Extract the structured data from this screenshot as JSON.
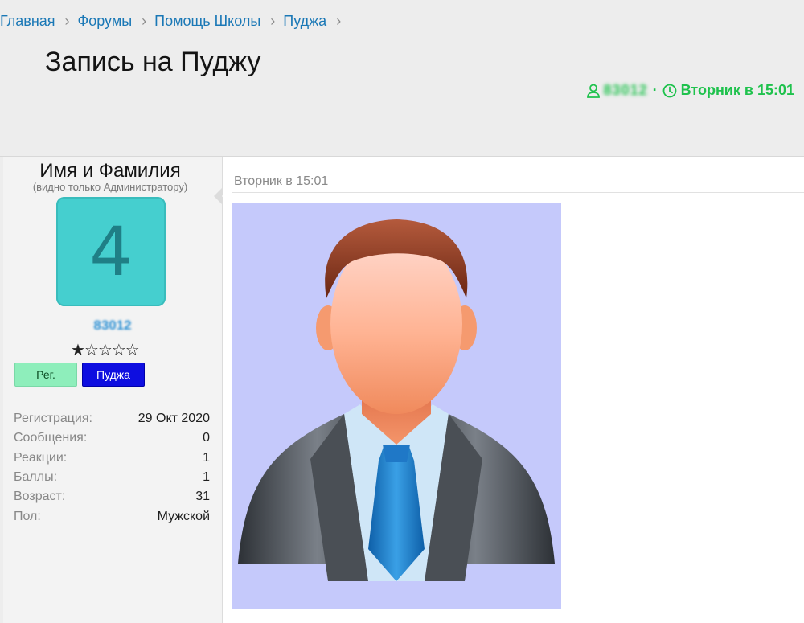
{
  "breadcrumb": [
    {
      "label": "Главная"
    },
    {
      "label": "Форумы"
    },
    {
      "label": "Помощь Школы"
    },
    {
      "label": "Пуджа"
    }
  ],
  "page_title": "Запись на Пуджу",
  "thread_meta": {
    "author": "83012",
    "separator": "·",
    "time": "Вторник в 15:01"
  },
  "user": {
    "name_title": "Имя и Фамилия",
    "name_note": "(видно только Администратору)",
    "avatar_letter": "4",
    "username": "83012",
    "rating_stars": 1,
    "rating_max": 5,
    "badges": [
      {
        "label": "Рег.",
        "color": "#8eeebb"
      },
      {
        "label": "Пуджа",
        "color": "#0e0ee0"
      }
    ],
    "stats": [
      {
        "label": "Регистрация:",
        "value": "29 Окт 2020"
      },
      {
        "label": "Сообщения:",
        "value": "0"
      },
      {
        "label": "Реакции:",
        "value": "1"
      },
      {
        "label": "Баллы:",
        "value": "1"
      },
      {
        "label": "Возраст:",
        "value": "31"
      },
      {
        "label": "Пол:",
        "value": "Мужской"
      }
    ]
  },
  "post": {
    "date": "Вторник в 15:01",
    "image": "man-in-suit-avatar-illustration"
  },
  "colors": {
    "link": "#1a78b6",
    "meta_green": "#1fc24d",
    "avatar_bg": "#45cfcf",
    "image_bg": "#c5c9fb"
  }
}
